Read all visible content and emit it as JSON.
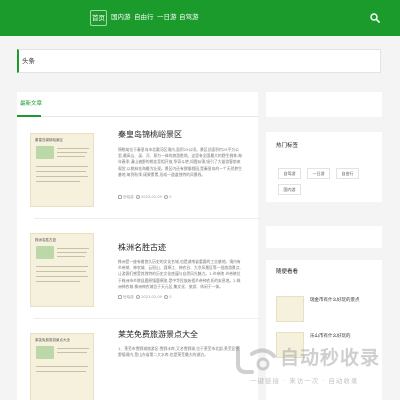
{
  "nav": {
    "home": "首页",
    "links": [
      "国内游",
      "自由行",
      "一日游",
      "自驾游"
    ]
  },
  "headline": "头条",
  "main": {
    "tab": "最新文章",
    "articles": [
      {
        "title": "秦皇岛锦桃峪景区",
        "thumb_title": "秦皇岛锦桃峪景区",
        "excerpt": "锦桃峪位于秦皇岛市北戴河区境内,面积25公顷。景区总面积约25平方公里,最高山、溪、河、泉为一体的旅游胜地。这里有全国最大的野生桃林,每年春季,漫山遍野的桃花竞相开放,争奇斗艳,如霞似锦,吸引了大量游客前来观赏,以桃林花海最为壮观。景区内还有猕猴桃园,是秦皇岛的一个天然养生基地,每到秋季,硕果累累,形成一道道独特的风景线。",
        "author": "世晓游",
        "date": "2023-02-09",
        "count": "0"
      },
      {
        "title": "株洲名胜古迹",
        "thumb_title": "株洲名胜古迹",
        "excerpt": "株洲是一座有着悠久历史的文化名城,也是湖南省重要的工业基地。境内有炎帝陵、神农城、云阳山、酒埠江、神农谷、大京风景区等一批旅游景点,让游客们感受其独特的历史文化底蕴与自然风光魅力。1.炎帝陵 炎帝陵位于株洲市炎陵县鹿原镇鹿原陂,是中华民族始祖炎帝神农氏的安息地。2.株洲神农城 株洲神农城位于天元区,集文化、旅游、休闲于一体。",
        "author": "世晓游",
        "date": "2023-02-09",
        "count": "0"
      },
      {
        "title": "莱芜免费旅游景点大全",
        "thumb_title": "莱芜免费旅游景点大全",
        "excerpt": "1、莱芜市雪野湖旅游区:雪野水库,又名雪野湖,位于莱芜市北部,莱芜区雪野镇境内,是山东省第二大水库,也是莱芜最大的湖泊。",
        "author": "世晓游",
        "date": "2023-02-09",
        "count": "0"
      }
    ]
  },
  "sidebar": {
    "hot_tags_title": "热门标签",
    "tags": [
      "自驾游",
      "一日游",
      "自由行",
      "国内游"
    ],
    "recommend_title": "随便看看",
    "recommend": [
      {
        "title": "瑞金市有什么好玩的景点"
      },
      {
        "title": "乐山市有什么好玩的"
      }
    ]
  },
  "watermark": {
    "text": "自动秒收录",
    "sub": "一键链接 · 来访一次 · 自动收录"
  },
  "colors": {
    "brand": "#1a9b2c",
    "background": "#f4f4f4"
  }
}
